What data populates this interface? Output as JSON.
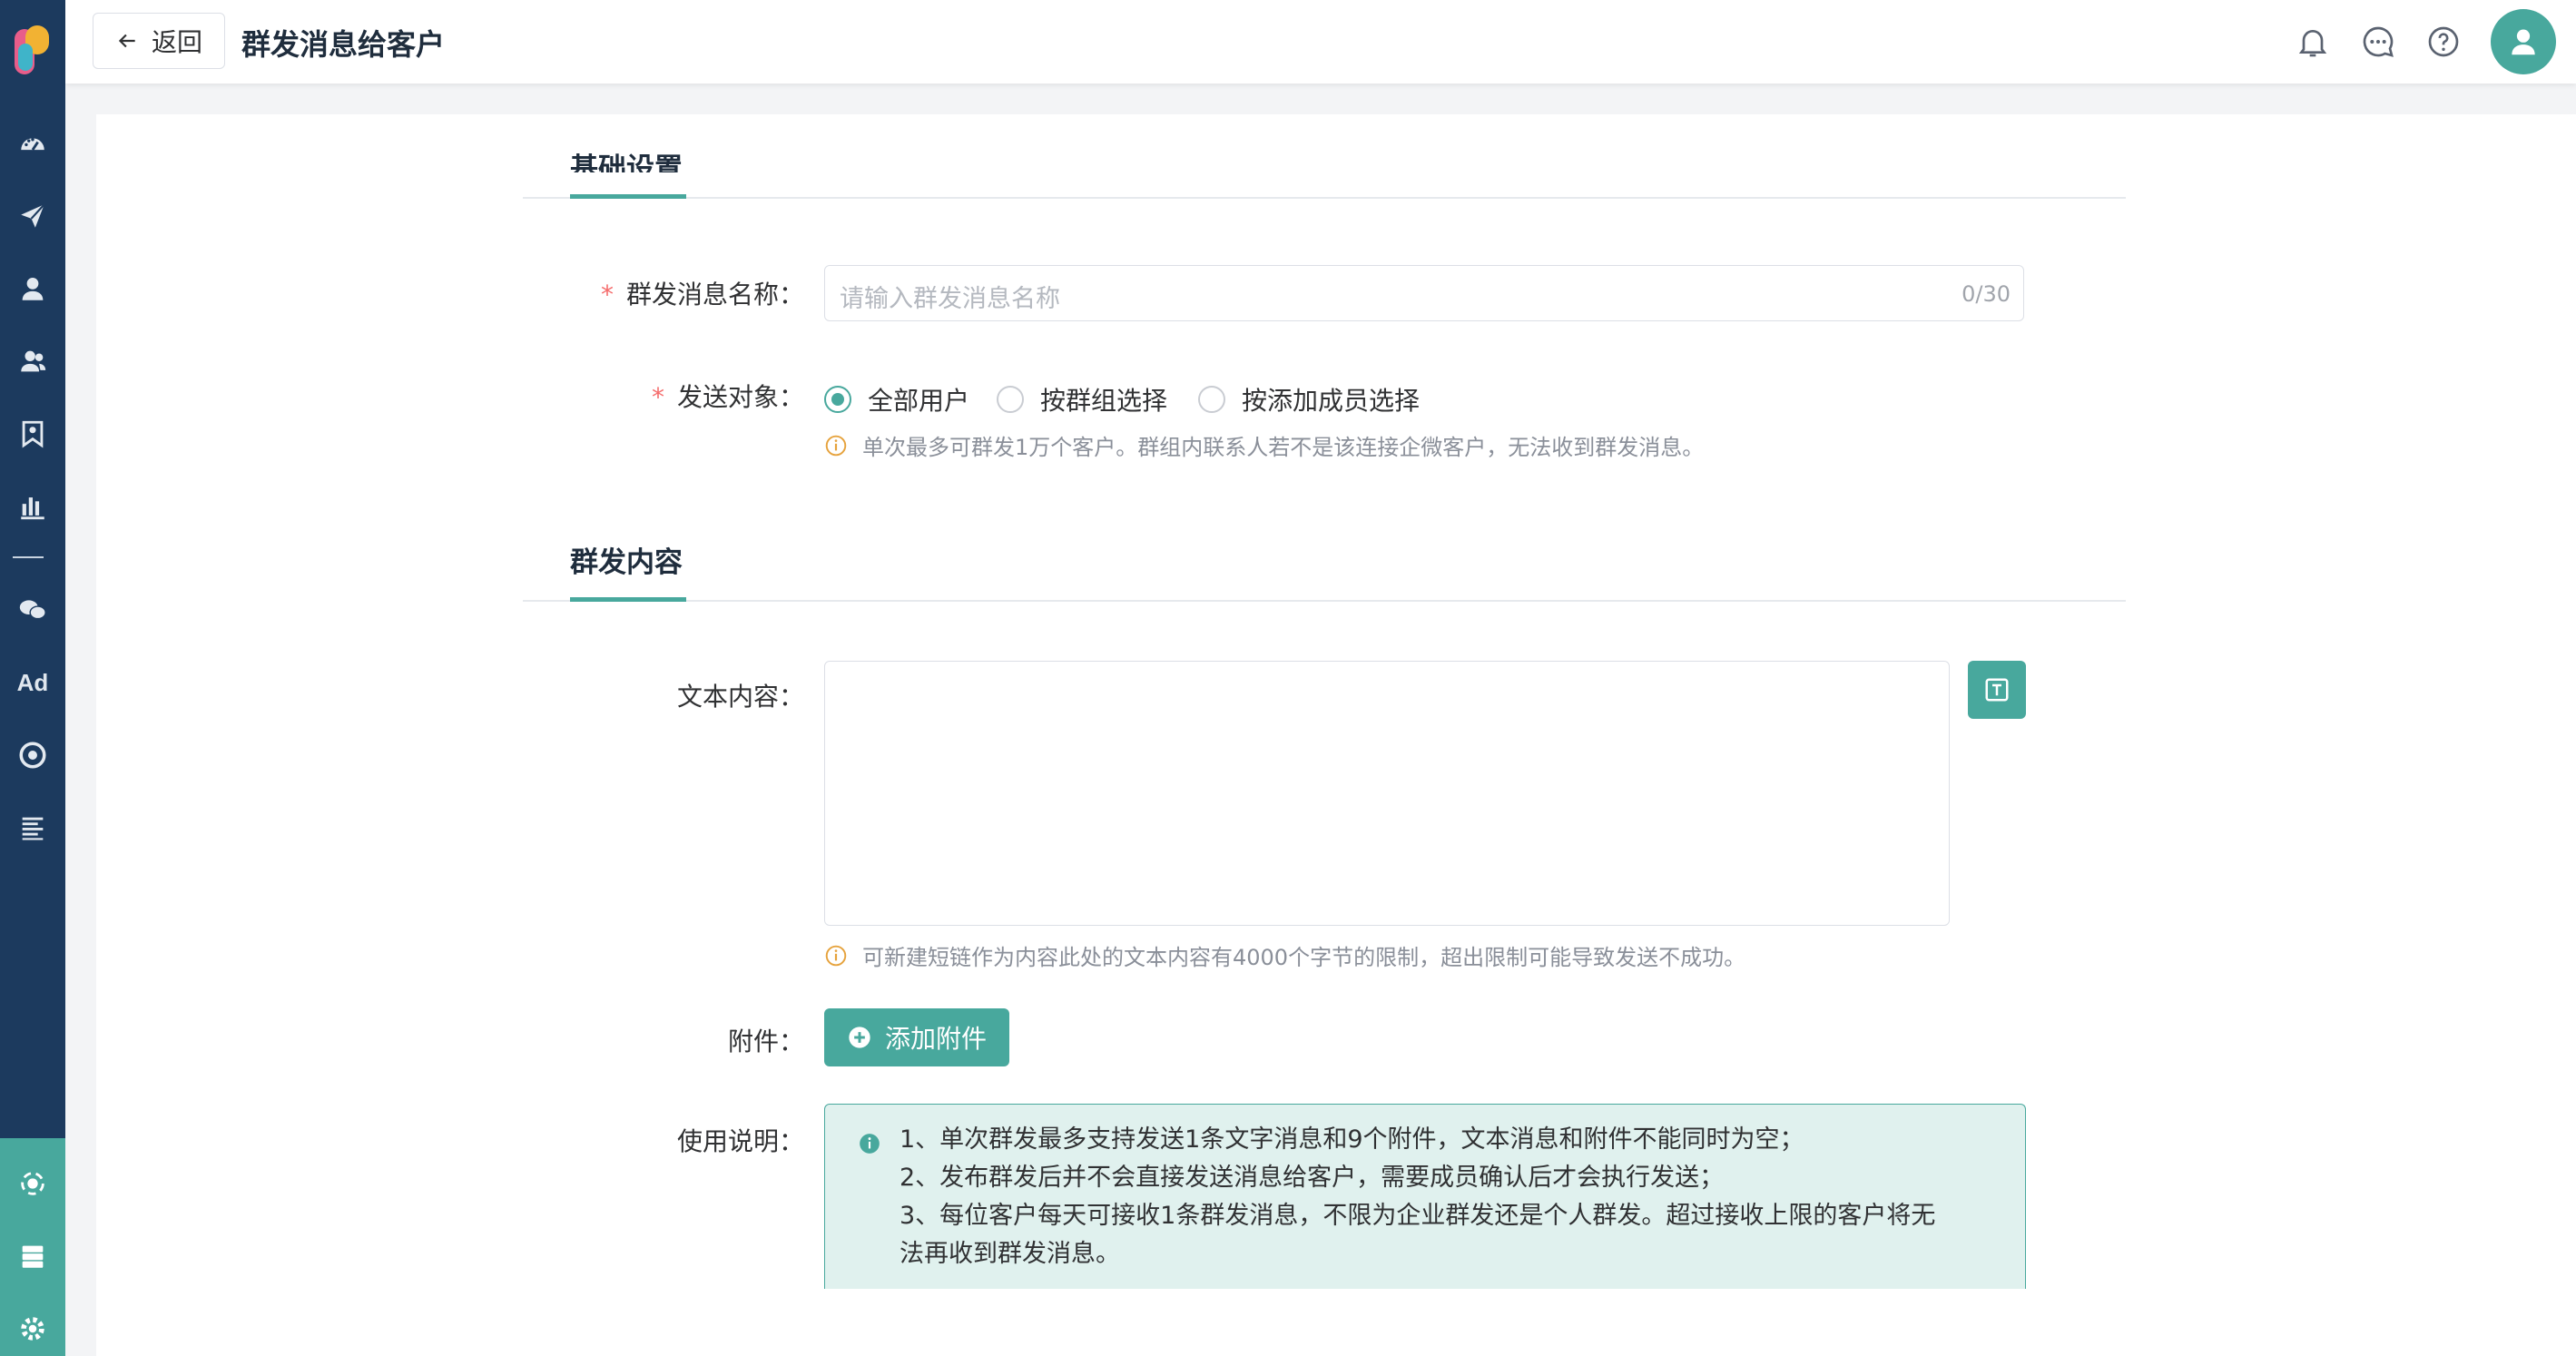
{
  "header": {
    "back_label": "返回",
    "title": "群发消息给客户"
  },
  "sidebar": {
    "items": [
      {
        "icon": "dashboard-icon"
      },
      {
        "icon": "paper-plane-icon"
      },
      {
        "icon": "user-icon"
      },
      {
        "icon": "users-icon"
      },
      {
        "icon": "bookmark-icon"
      },
      {
        "icon": "bar-chart-icon"
      },
      {
        "icon": "wechat-icon"
      },
      {
        "icon": "ad-icon",
        "label": "Ad"
      },
      {
        "icon": "target-icon"
      },
      {
        "icon": "list-icon"
      }
    ],
    "bottom_items": [
      {
        "icon": "network-icon"
      },
      {
        "icon": "server-icon"
      },
      {
        "icon": "gear-icon"
      }
    ]
  },
  "form": {
    "basic_section_title": "基础设置",
    "name_label": "群发消息名称：",
    "name_placeholder": "请输入群发消息名称",
    "name_count": "0/30",
    "target_label": "发送对象：",
    "target_options": [
      "全部用户",
      "按群组选择",
      "按添加成员选择"
    ],
    "target_selected": "全部用户",
    "target_hint": "单次最多可群发1万个客户。群组内联系人若不是该连接企微客户，无法收到群发消息。",
    "content_section_title": "群发内容",
    "text_label": "文本内容：",
    "text_hint": "可新建短链作为内容此处的文本内容有4000个字节的限制，超出限制可能导致发送不成功。",
    "attach_label": "附件：",
    "attach_button": "添加附件",
    "usage_label": "使用说明：",
    "usage_lines": [
      "1、单次群发最多支持发送1条文字消息和9个附件，文本消息和附件不能同时为空；",
      "2、发布群发后并不会直接发送消息给客户，需要成员确认后才会执行发送；",
      "3、每位客户每天可接收1条群发消息，不限为企业群发还是个人群发。超过接收上限的客户将无",
      "法再收到群发消息。"
    ]
  },
  "colors": {
    "accent": "#48a89d",
    "sidebar": "#1c3a5e",
    "required": "#f56c6c",
    "warning": "#e6a23c"
  }
}
